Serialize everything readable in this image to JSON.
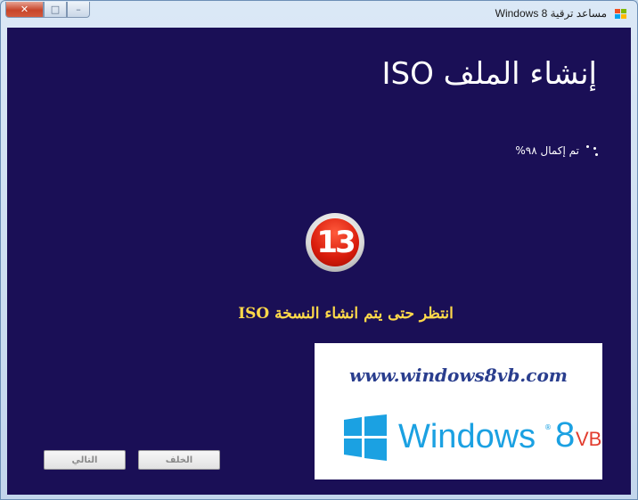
{
  "window": {
    "title": "مساعد ترقية Windows 8",
    "controls": {
      "minimize": "–",
      "maximize": "□",
      "close": "✕"
    }
  },
  "page": {
    "heading": "إنشاء الملف ISO",
    "progress_text": "تم إكمال ٩٨%",
    "progress_percent": 98
  },
  "overlay": {
    "badge_number": "13",
    "wait_message": "انتظر حتى يتم انشاء النسخة ISO"
  },
  "promo": {
    "url": "www.windows8vb.com",
    "logo_word": "Windows",
    "logo_number": "8",
    "logo_suffix": "VB",
    "logo_reg": "®"
  },
  "buttons": {
    "next": "التالي",
    "back": "الخلف"
  },
  "colors": {
    "background": "#1a0f56",
    "heading": "#ffffff",
    "wait_message": "#ffd94a",
    "brand_blue": "#1ba1e2",
    "brand_red": "#e23c2e"
  }
}
